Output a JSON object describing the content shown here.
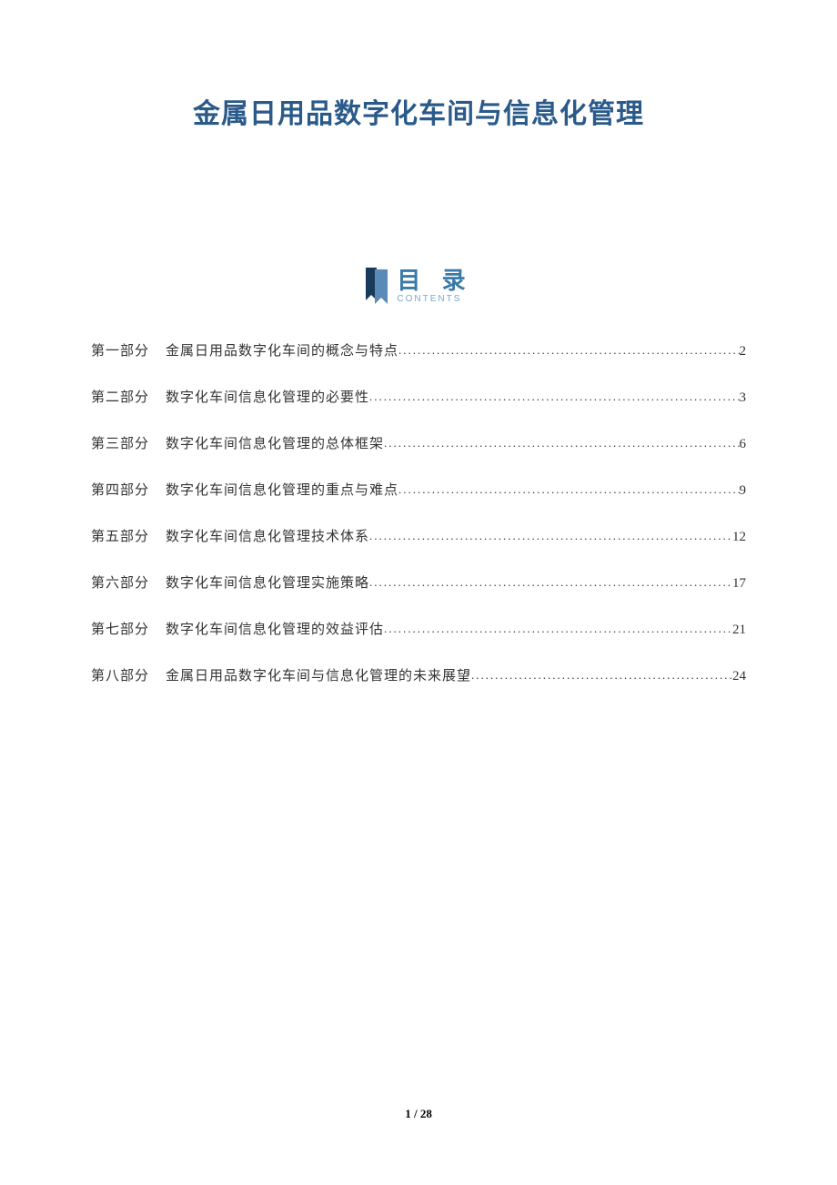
{
  "title": "金属日用品数字化车间与信息化管理",
  "toc_header": {
    "label": "目 录",
    "sublabel": "CONTENTS"
  },
  "toc": [
    {
      "part": "第一部分",
      "title": "金属日用品数字化车间的概念与特点",
      "page": "2"
    },
    {
      "part": "第二部分",
      "title": "数字化车间信息化管理的必要性",
      "page": "3"
    },
    {
      "part": "第三部分",
      "title": "数字化车间信息化管理的总体框架",
      "page": "6"
    },
    {
      "part": "第四部分",
      "title": "数字化车间信息化管理的重点与难点",
      "page": "9"
    },
    {
      "part": "第五部分",
      "title": "数字化车间信息化管理技术体系",
      "page": "12"
    },
    {
      "part": "第六部分",
      "title": "数字化车间信息化管理实施策略",
      "page": "17"
    },
    {
      "part": "第七部分",
      "title": "数字化车间信息化管理的效益评估",
      "page": "21"
    },
    {
      "part": "第八部分",
      "title": "金属日用品数字化车间与信息化管理的未来展望",
      "page": "24"
    }
  ],
  "footer": {
    "current": "1",
    "sep": " / ",
    "total": "28"
  }
}
